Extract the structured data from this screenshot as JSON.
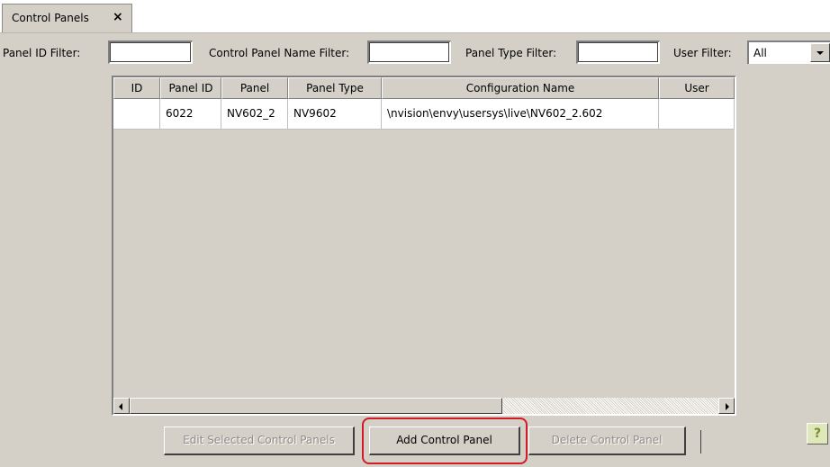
{
  "tab": {
    "label": "Control Panels",
    "close": "×"
  },
  "filters": {
    "panel_id_label": "Panel ID Filter:",
    "panel_id_value": "",
    "panel_name_label": "Control Panel Name Filter:",
    "panel_name_value": "",
    "panel_type_label": "Panel Type Filter:",
    "panel_type_value": "",
    "user_label": "User Filter:",
    "user_value": "All"
  },
  "table": {
    "columns": [
      "ID",
      "Panel ID",
      "Panel",
      "Panel Type",
      "Configuration Name",
      "User"
    ],
    "rows": [
      [
        "",
        "6022",
        "NV602_2",
        "NV9602",
        "\\nvision\\envy\\usersys\\live\\NV602_2.602",
        ""
      ]
    ]
  },
  "buttons": {
    "edit": "Edit Selected Control Panels",
    "add": "Add Control Panel",
    "delete": "Delete Control Panel",
    "help": "?"
  },
  "colors": {
    "highlight": "#d01c24",
    "background": "#d4d0c8"
  }
}
